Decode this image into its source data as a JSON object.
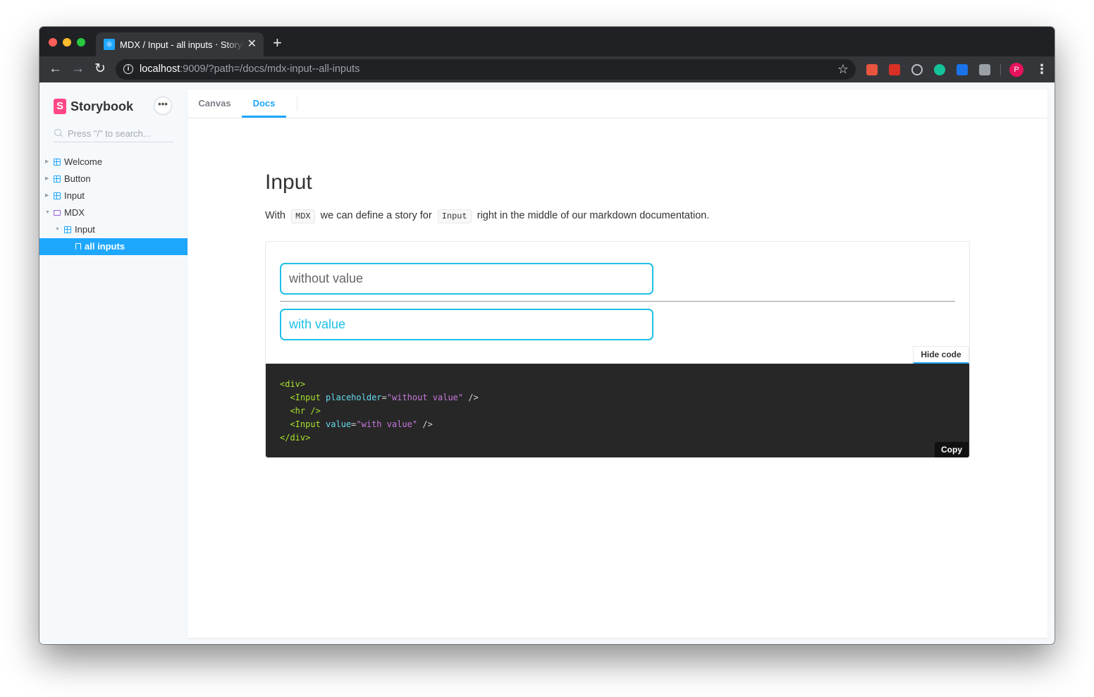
{
  "browser": {
    "tab_title": "MDX / Input - all inputs ⋅ Storybook",
    "tab_close": "✕",
    "new_tab": "+",
    "url_host": "localhost",
    "url_rest": ":9009/?path=/docs/mdx-input--all-inputs",
    "profile_initial": "P",
    "icons": [
      "back-icon",
      "forward-icon",
      "reload-icon",
      "info-icon",
      "star-icon",
      "extension-icons",
      "menu-icon"
    ]
  },
  "sidebar": {
    "brand": "Storybook",
    "brand_logo": "S",
    "more_label": "•••",
    "search_placeholder": "Press \"/\" to search...",
    "items": [
      {
        "label": "Welcome"
      },
      {
        "label": "Button"
      },
      {
        "label": "Input"
      },
      {
        "label": "MDX"
      },
      {
        "label": "Input"
      },
      {
        "label": "all inputs"
      }
    ]
  },
  "main": {
    "tabs": [
      {
        "label": "Canvas"
      },
      {
        "label": "Docs"
      }
    ],
    "active_tab": "Docs",
    "title": "Input",
    "paragraph": {
      "part1": "With",
      "code1": "MDX",
      "part2": "we can define a story for",
      "code2": "Input",
      "part3": "right in the middle of our markdown documentation."
    },
    "preview": {
      "input1_placeholder": "without value",
      "input2_value": "with value",
      "hide_code_label": "Hide code",
      "copy_label": "Copy"
    },
    "code": {
      "open_div": "<div>",
      "close_div": "</div>",
      "input_tag": "<Input",
      "attr_placeholder": "placeholder",
      "val_placeholder": "\"without value\"",
      "hr": "<hr />",
      "attr_value": "value",
      "val_value": "\"with value\"",
      "self_close": "/>",
      "equals": "="
    }
  },
  "colors": {
    "accent": "#1ea7fd",
    "input_border": "#1ec0e8",
    "brand_pink": "#ff4785",
    "code_bg": "#272727"
  }
}
